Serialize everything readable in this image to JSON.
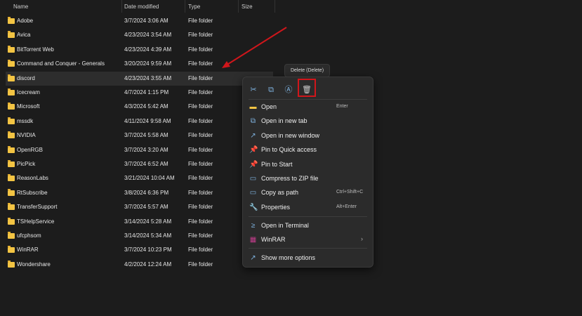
{
  "columns": {
    "name": "Name",
    "date": "Date modified",
    "type": "Type",
    "size": "Size"
  },
  "rows": [
    {
      "name": "Adobe",
      "date": "3/7/2024 3:06 AM",
      "type": "File folder"
    },
    {
      "name": "Avica",
      "date": "4/23/2024 3:54 AM",
      "type": "File folder"
    },
    {
      "name": "BitTorrent Web",
      "date": "4/23/2024 4:39 AM",
      "type": "File folder"
    },
    {
      "name": "Command and Conquer - Generals",
      "date": "3/20/2024 9:59 AM",
      "type": "File folder"
    },
    {
      "name": "discord",
      "date": "4/23/2024 3:55 AM",
      "type": "File folder"
    },
    {
      "name": "Icecream",
      "date": "4/7/2024 1:15 PM",
      "type": "File folder"
    },
    {
      "name": "Microsoft",
      "date": "4/3/2024 5:42 AM",
      "type": "File folder"
    },
    {
      "name": "mssdk",
      "date": "4/11/2024 9:58 AM",
      "type": "File folder"
    },
    {
      "name": "NVIDIA",
      "date": "3/7/2024 5:58 AM",
      "type": "File folder"
    },
    {
      "name": "OpenRGB",
      "date": "3/7/2024 3:20 AM",
      "type": "File folder"
    },
    {
      "name": "PicPick",
      "date": "3/7/2024 6:52 AM",
      "type": "File folder"
    },
    {
      "name": "ReasonLabs",
      "date": "3/21/2024 10:04 AM",
      "type": "File folder"
    },
    {
      "name": "RtSubscribe",
      "date": "3/8/2024 6:36 PM",
      "type": "File folder"
    },
    {
      "name": "TransferSupport",
      "date": "3/7/2024 5:57 AM",
      "type": "File folder"
    },
    {
      "name": "TSHelpService",
      "date": "3/14/2024 5:28 AM",
      "type": "File folder"
    },
    {
      "name": "ufcphsom",
      "date": "3/14/2024 5:34 AM",
      "type": "File folder"
    },
    {
      "name": "WinRAR",
      "date": "3/7/2024 10:23 PM",
      "type": "File folder"
    },
    {
      "name": "Wondershare",
      "date": "4/2/2024 12:24 AM",
      "type": "File folder"
    }
  ],
  "tooltip": "Delete (Delete)",
  "menu": [
    {
      "label": "Open",
      "shortcut": "Enter",
      "icon": "folder-icon"
    },
    {
      "label": "Open in new tab",
      "shortcut": "",
      "icon": "new-tab-icon"
    },
    {
      "label": "Open in new window",
      "shortcut": "",
      "icon": "new-window-icon"
    },
    {
      "label": "Pin to Quick access",
      "shortcut": "",
      "icon": "pin-icon"
    },
    {
      "label": "Pin to Start",
      "shortcut": "",
      "icon": "pin-icon"
    },
    {
      "label": "Compress to ZIP file",
      "shortcut": "",
      "icon": "zip-icon"
    },
    {
      "label": "Copy as path",
      "shortcut": "Ctrl+Shift+C",
      "icon": "path-icon"
    },
    {
      "label": "Properties",
      "shortcut": "Alt+Enter",
      "icon": "wrench-icon"
    },
    {
      "label": "Open in Terminal",
      "shortcut": "",
      "icon": "terminal-icon"
    },
    {
      "label": "WinRAR",
      "shortcut": "",
      "icon": "winrar-icon"
    },
    {
      "label": "Show more options",
      "shortcut": "",
      "icon": "more-options-icon"
    }
  ],
  "highlight_color": "#d0161b"
}
